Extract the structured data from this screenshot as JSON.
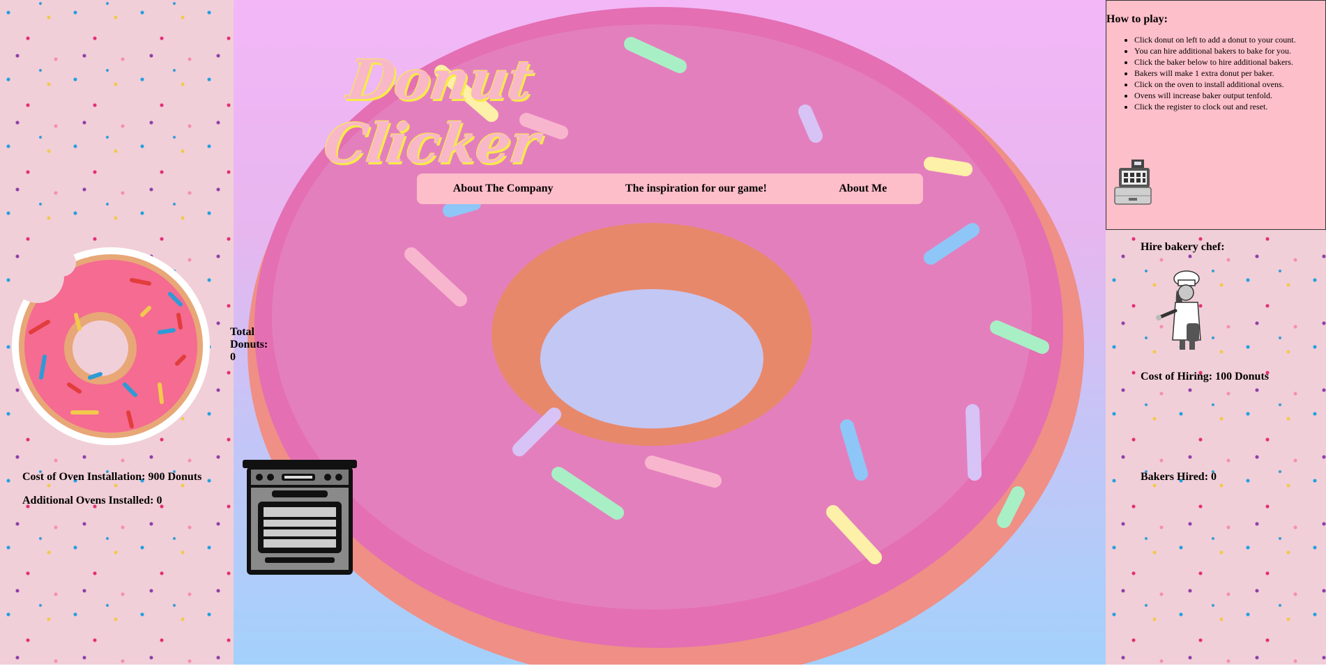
{
  "title": "Donut Clicker",
  "nav": {
    "items": [
      "About The Company",
      "The inspiration for our game!",
      "About Me"
    ]
  },
  "counter": {
    "label": "Total Donuts:",
    "value": "0"
  },
  "oven": {
    "cost_label": "Cost of Oven Installation: 900 Donuts",
    "installed_label": "Additional Ovens Installed: 0"
  },
  "how_to_play": {
    "heading": "How to play:",
    "steps": [
      "Click donut on left to add a donut to your count.",
      "You can hire additional bakers to bake for you.",
      "Click the baker below to hire additional bakers.",
      "Bakers will make 1 extra donut per baker.",
      "Click on the oven to install additional ovens.",
      "Ovens will increase baker output tenfold.",
      "Click the register to clock out and reset."
    ]
  },
  "baker": {
    "hire_title": "Hire bakery chef:",
    "cost_label": "Cost of Hiring: 100 Donuts",
    "hired_label": "Bakers Hired: 0"
  },
  "icons": {
    "clicker": "donut-icon",
    "oven": "oven-icon",
    "register": "cash-register-icon",
    "chef": "baker-chef-icon"
  }
}
